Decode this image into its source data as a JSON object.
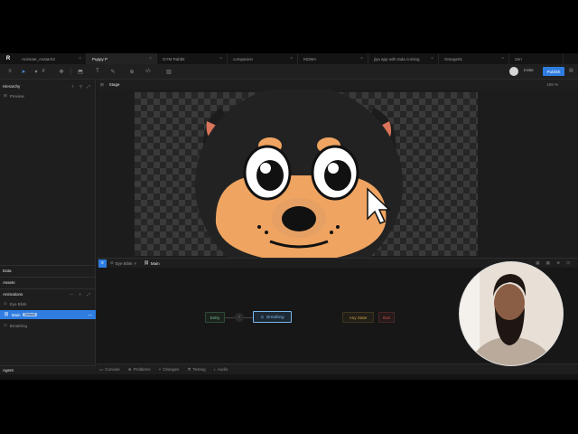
{
  "tabs": [
    {
      "label": "Animate_Avatar02",
      "active": false
    },
    {
      "label": "Puppy P",
      "active": true
    },
    {
      "label": "GYM Rabbit",
      "active": false
    },
    {
      "label": "companion",
      "active": false
    },
    {
      "label": "KIDMA",
      "active": false
    },
    {
      "label": "jiya app with tada coming",
      "active": false
    },
    {
      "label": "Orange01",
      "active": false
    },
    {
      "label": "Zen",
      "active": false
    }
  ],
  "toolbar": {
    "invite_label": "Invite",
    "publish_label": "Publish"
  },
  "sidebar": {
    "hierarchy_title": "Hierarchy",
    "hierarchy_items": [
      {
        "label": "Preview"
      }
    ],
    "data_title": "Data",
    "assets_title": "Assets",
    "animations_title": "Animations",
    "animations": [
      {
        "label": "Eye Blink",
        "selected": false
      },
      {
        "label": "Main",
        "selected": true,
        "badge": "Default"
      },
      {
        "label": "Breathing",
        "selected": false
      }
    ],
    "agent_title": "Agent"
  },
  "stage": {
    "title": "Stage",
    "zoom": "189 %"
  },
  "anim_tabs": [
    {
      "label": "Eye Blink",
      "active": false
    },
    {
      "label": "Main",
      "active": true
    }
  ],
  "graph": {
    "nodes": [
      {
        "label": "Entry"
      },
      {
        "label": "Breathing"
      },
      {
        "label": "Any State"
      },
      {
        "label": "Exit"
      }
    ]
  },
  "bottom_tabs": [
    {
      "label": "Console"
    },
    {
      "label": "Problems"
    },
    {
      "label": "Changes"
    },
    {
      "label": "Testing"
    },
    {
      "label": "Audio"
    }
  ],
  "colors": {
    "accent": "#2f7de1",
    "entry": "#7fbf8f",
    "any_state": "#c9a24a",
    "exit": "#d9534f",
    "node_blue": "#7ab6ea"
  }
}
